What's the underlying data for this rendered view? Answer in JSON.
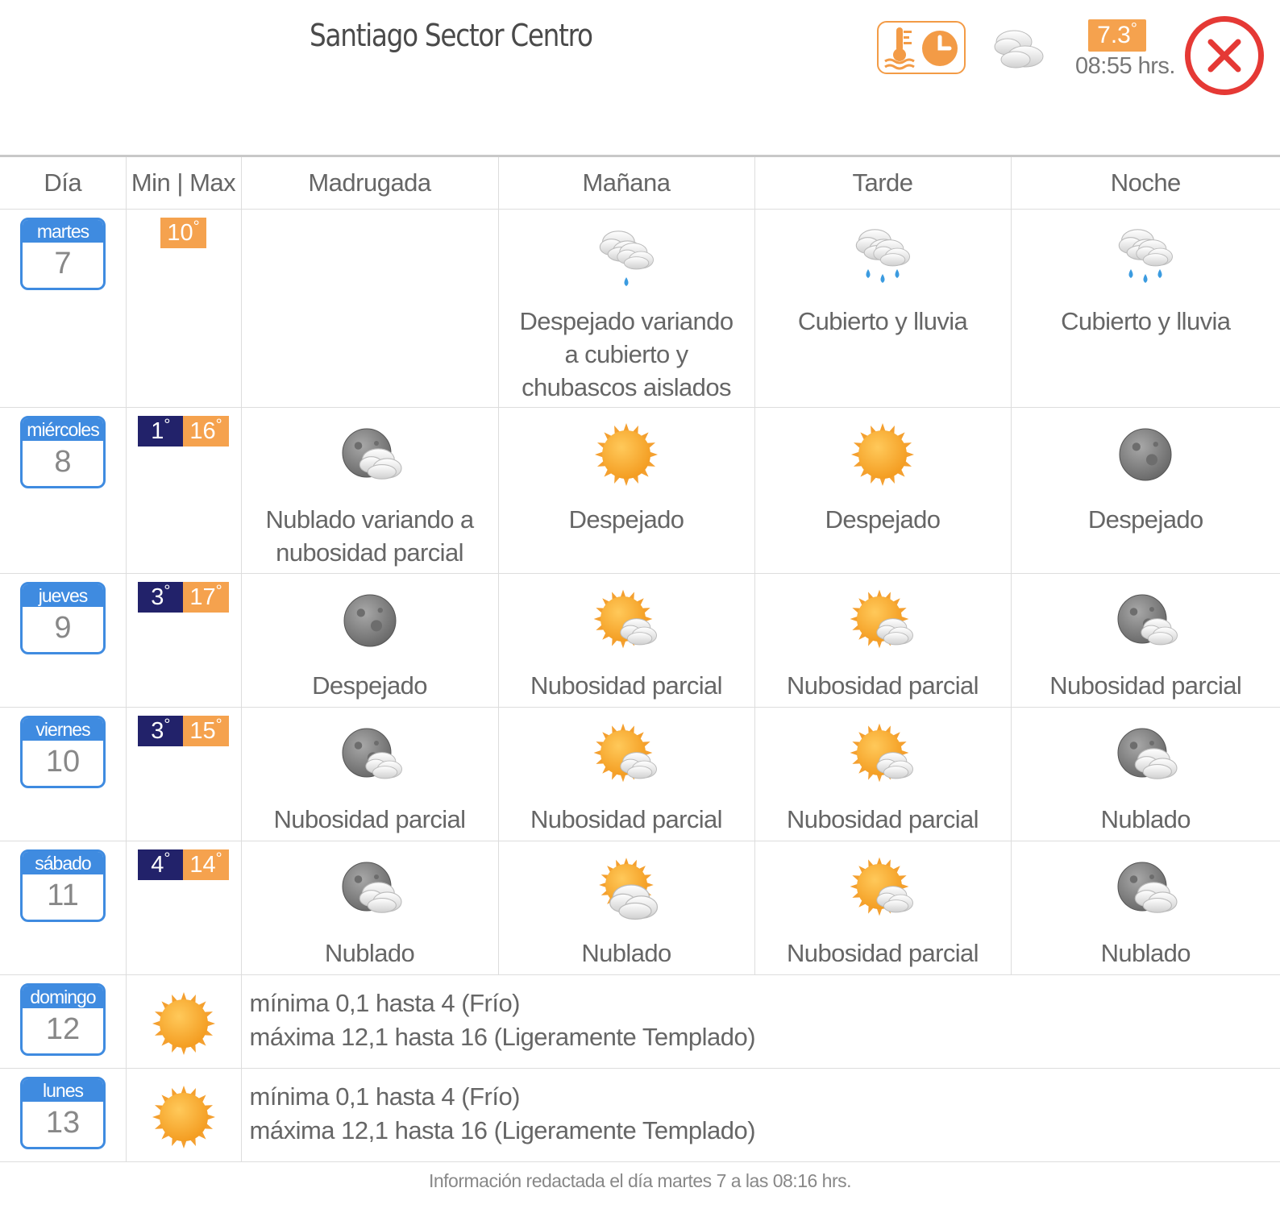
{
  "header": {
    "title": "Santiago Sector Centro",
    "current_temp": "7.3",
    "current_time": "08:55 hrs.",
    "icons": {
      "history": "thermometer-clock-icon",
      "current": "cloud-icon",
      "close": "close-icon"
    },
    "colors": {
      "accent": "#f5a24e",
      "close": "#e53935",
      "day": "#3f8be0",
      "min": "#22226a"
    }
  },
  "columns": [
    "Día",
    "Min | Max",
    "Madrugada",
    "Mañana",
    "Tarde",
    "Noche"
  ],
  "days": [
    {
      "name": "martes",
      "num": "7",
      "min": "",
      "max": "10",
      "periods": [
        {
          "icon": "",
          "desc": ""
        },
        {
          "icon": "showers",
          "desc": "Despejado variando a cubierto y chubascos aislados"
        },
        {
          "icon": "rain",
          "desc": "Cubierto y lluvia"
        },
        {
          "icon": "rain",
          "desc": "Cubierto y lluvia"
        }
      ]
    },
    {
      "name": "miércoles",
      "num": "8",
      "min": "1",
      "max": "16",
      "periods": [
        {
          "icon": "moon-cloudy",
          "desc": "Nublado variando a nubosidad parcial"
        },
        {
          "icon": "sun",
          "desc": "Despejado"
        },
        {
          "icon": "sun",
          "desc": "Despejado"
        },
        {
          "icon": "moon",
          "desc": "Despejado"
        }
      ]
    },
    {
      "name": "jueves",
      "num": "9",
      "min": "3",
      "max": "17",
      "periods": [
        {
          "icon": "moon",
          "desc": "Despejado"
        },
        {
          "icon": "sun-cloud",
          "desc": "Nubosidad parcial"
        },
        {
          "icon": "sun-cloud",
          "desc": "Nubosidad parcial"
        },
        {
          "icon": "moon-cloud",
          "desc": "Nubosidad parcial"
        }
      ]
    },
    {
      "name": "viernes",
      "num": "10",
      "min": "3",
      "max": "15",
      "periods": [
        {
          "icon": "moon-cloud",
          "desc": "Nubosidad parcial"
        },
        {
          "icon": "sun-cloud",
          "desc": "Nubosidad parcial"
        },
        {
          "icon": "sun-cloud",
          "desc": "Nubosidad parcial"
        },
        {
          "icon": "moon-cloudy",
          "desc": "Nublado"
        }
      ]
    },
    {
      "name": "sábado",
      "num": "11",
      "min": "4",
      "max": "14",
      "periods": [
        {
          "icon": "moon-cloudy",
          "desc": "Nublado"
        },
        {
          "icon": "sun-cloudy",
          "desc": "Nublado"
        },
        {
          "icon": "sun-cloud",
          "desc": "Nubosidad parcial"
        },
        {
          "icon": "moon-cloudy",
          "desc": "Nublado"
        }
      ]
    }
  ],
  "extended": [
    {
      "name": "domingo",
      "num": "12",
      "icon": "sun",
      "line1": "mínima 0,1 hasta 4 (Frío)",
      "line2": "máxima 12,1 hasta 16 (Ligeramente Templado)"
    },
    {
      "name": "lunes",
      "num": "13",
      "icon": "sun",
      "line1": "mínima 0,1 hasta 4 (Frío)",
      "line2": "máxima 12,1 hasta 16 (Ligeramente Templado)"
    }
  ],
  "footer": "Información redactada el día martes 7 a las 08:16 hrs."
}
